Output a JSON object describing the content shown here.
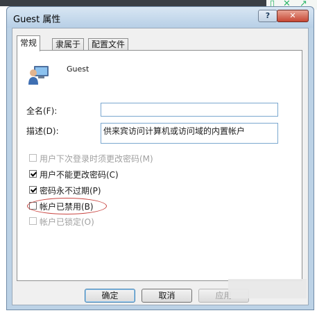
{
  "window": {
    "title": "Guest 属性",
    "help_label": "?",
    "close_label": "✕"
  },
  "tabs": [
    {
      "label": "常规",
      "active": true
    },
    {
      "label": "隶属于",
      "active": false
    },
    {
      "label": "配置文件",
      "active": false
    }
  ],
  "general": {
    "username": "Guest",
    "fullname_label": "全名(F):",
    "fullname_value": "",
    "description_label": "描述(D):",
    "description_value": "供来宾访问计算机或访问域的内置帐户"
  },
  "checkboxes": [
    {
      "label": "用户下次登录时须更改密码(M)",
      "checked": false,
      "disabled": true
    },
    {
      "label": "用户不能更改密码(C)",
      "checked": true,
      "disabled": false
    },
    {
      "label": "密码永不过期(P)",
      "checked": true,
      "disabled": false
    },
    {
      "label": "帐户已禁用(B)",
      "checked": false,
      "disabled": false
    },
    {
      "label": "帐户已锁定(O)",
      "checked": false,
      "disabled": true
    }
  ],
  "buttons": {
    "ok": "确定",
    "cancel": "取消",
    "apply": "应用"
  },
  "colors": {
    "annotation_circle": "#c8433f",
    "field_border": "#7aa7cf"
  }
}
